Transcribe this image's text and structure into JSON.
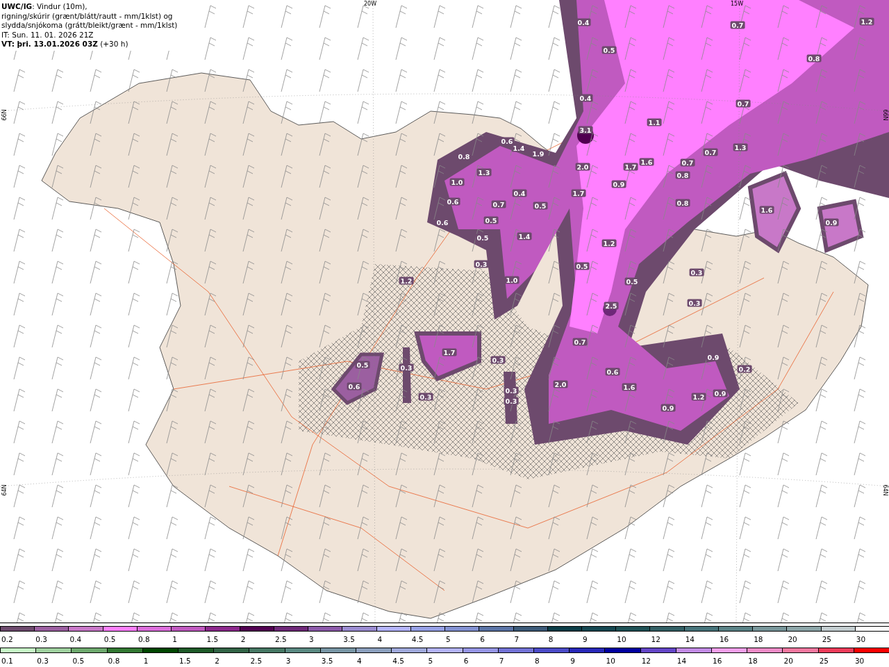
{
  "header": {
    "lines": [
      "**UWC/IG**: Vindur (10m),",
      "rigning/skúrir (grænt/blátt/rautt - mm/1klst) og",
      "slydda/snjókoma (grátt/bleikt/grænt - mm/1klst)",
      "IT: Sun. 11. 01. 2026 21Z",
      "**VT: þri. 13.01.2026 03Z** (+30 h)"
    ]
  },
  "map": {
    "grid_labels": [
      "20W",
      "15W",
      "66N",
      "66N",
      "64N",
      "64N"
    ],
    "values": [
      "0.4",
      "0.5",
      "0.7",
      "1.2",
      "0.8",
      "0.4",
      "0.7",
      "3.1",
      "1.1",
      "0.6",
      "1.4",
      "1.9",
      "0.8",
      "1.3",
      "2.0",
      "1.7",
      "1.6",
      "0.7",
      "1.3",
      "0.7",
      "0.8",
      "1.0",
      "0.9",
      "1.7",
      "0.4",
      "0.7",
      "0.5",
      "0.8",
      "1.6",
      "0.6",
      "0.5",
      "0.6",
      "0.9",
      "0.5",
      "1.4",
      "1.2",
      "0.3",
      "0.5",
      "0.3",
      "1.2",
      "1.0",
      "0.5",
      "0.3",
      "2.5",
      "0.7",
      "1.7",
      "0.5",
      "0.3",
      "0.3",
      "0.9",
      "0.2",
      "0.6",
      "0.6",
      "2.0",
      "1.6",
      "0.3",
      "0.3",
      "0.3",
      "1.2",
      "0.9",
      "0.9"
    ]
  },
  "legend": {
    "snow": [
      {
        "label": "0.2",
        "color": "#6d4a6d"
      },
      {
        "label": "0.3",
        "color": "#9b5fa0"
      },
      {
        "label": "0.4",
        "color": "#c878c8"
      },
      {
        "label": "0.5",
        "color": "#ff80ff"
      },
      {
        "label": "0.8",
        "color": "#dc6edc"
      },
      {
        "label": "1",
        "color": "#c05ac0"
      },
      {
        "label": "1.5",
        "color": "#8c288c"
      },
      {
        "label": "2",
        "color": "#500050"
      },
      {
        "label": "2.5",
        "color": "#6e2878"
      },
      {
        "label": "3",
        "color": "#8c5aaa"
      },
      {
        "label": "3.5",
        "color": "#9b8cd2"
      },
      {
        "label": "4",
        "color": "#b4b4ff"
      },
      {
        "label": "4.5",
        "color": "#96a0e6"
      },
      {
        "label": "5",
        "color": "#8291d2"
      },
      {
        "label": "6",
        "color": "#5a73a5"
      },
      {
        "label": "7",
        "color": "#3c5a78"
      },
      {
        "label": "8",
        "color": "#0a3c46"
      },
      {
        "label": "9",
        "color": "#144650"
      },
      {
        "label": "10",
        "color": "#1e5055"
      },
      {
        "label": "12",
        "color": "#325f64"
      },
      {
        "label": "14",
        "color": "#46737a"
      },
      {
        "label": "16",
        "color": "#5a8286"
      },
      {
        "label": "18",
        "color": "#78969a"
      },
      {
        "label": "20",
        "color": "#8ca5a8"
      },
      {
        "label": "25",
        "color": "#c3cdd0"
      },
      {
        "label": "30",
        "color": "#ffffff"
      }
    ],
    "rain": [
      {
        "label": "0.1",
        "color": "#c8fac8"
      },
      {
        "label": "0.3",
        "color": "#a0d2a0"
      },
      {
        "label": "0.5",
        "color": "#6eaa6e"
      },
      {
        "label": "0.8",
        "color": "#327832"
      },
      {
        "label": "1",
        "color": "#004600"
      },
      {
        "label": "1.5",
        "color": "#1e5a28"
      },
      {
        "label": "2",
        "color": "#326446"
      },
      {
        "label": "2.5",
        "color": "#467864"
      },
      {
        "label": "3",
        "color": "#5a8a82"
      },
      {
        "label": "3.5",
        "color": "#7896a5"
      },
      {
        "label": "4",
        "color": "#8ca0be"
      },
      {
        "label": "4.5",
        "color": "#a0aadc"
      },
      {
        "label": "5",
        "color": "#b4b4fa"
      },
      {
        "label": "6",
        "color": "#9696e6"
      },
      {
        "label": "7",
        "color": "#7373d7"
      },
      {
        "label": "8",
        "color": "#4b4bc8"
      },
      {
        "label": "9",
        "color": "#2828b9"
      },
      {
        "label": "10",
        "color": "#0000a0"
      },
      {
        "label": "12",
        "color": "#6446c8"
      },
      {
        "label": "14",
        "color": "#c38ce6"
      },
      {
        "label": "16",
        "color": "#f5a0eb"
      },
      {
        "label": "18",
        "color": "#f08cc8"
      },
      {
        "label": "20",
        "color": "#f578a0"
      },
      {
        "label": "25",
        "color": "#f03c5a"
      },
      {
        "label": "30",
        "color": "#ff0000"
      }
    ]
  }
}
